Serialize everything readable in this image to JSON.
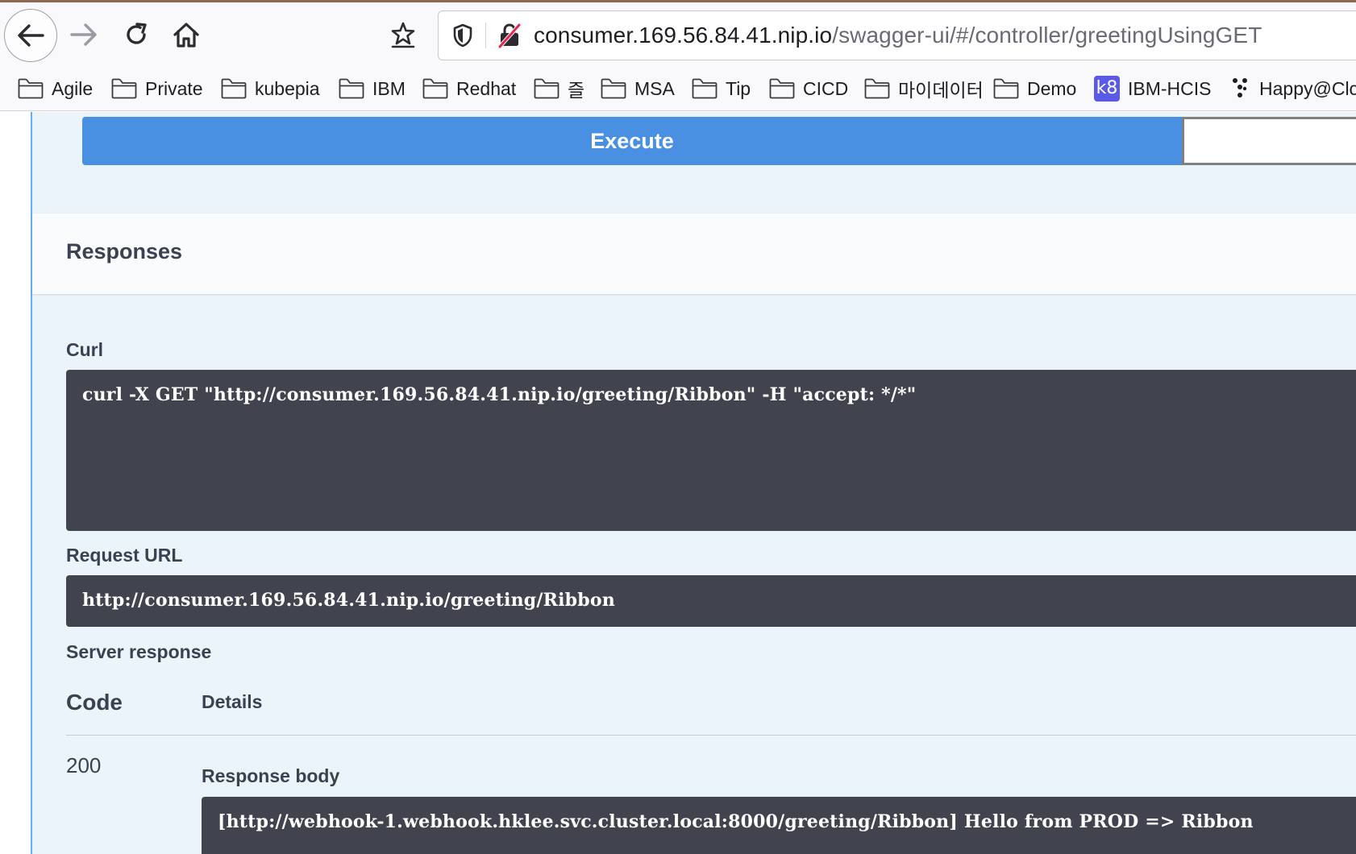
{
  "browser": {
    "url_host": "consumer.169.56.84.41.nip.io",
    "url_path": "/swagger-ui/#/controller/greetingUsingGET"
  },
  "bookmarks": [
    {
      "label": "Agile",
      "icon": "folder-icon"
    },
    {
      "label": "Private",
      "icon": "folder-icon"
    },
    {
      "label": "kubepia",
      "icon": "folder-icon"
    },
    {
      "label": "IBM",
      "icon": "folder-icon"
    },
    {
      "label": "Redhat",
      "icon": "folder-icon"
    },
    {
      "label": "즐",
      "icon": "folder-icon"
    },
    {
      "label": "MSA",
      "icon": "folder-icon"
    },
    {
      "label": "Tip",
      "icon": "folder-icon"
    },
    {
      "label": "CICD",
      "icon": "folder-icon"
    },
    {
      "label": "마이데이터",
      "icon": "folder-icon"
    },
    {
      "label": "Demo",
      "icon": "folder-icon"
    },
    {
      "label": "IBM-HCIS",
      "icon": "k8s-icon",
      "badge": "k8"
    },
    {
      "label": "Happy@Clc",
      "icon": "dots-icon"
    }
  ],
  "swagger": {
    "execute_label": "Execute",
    "responses_title": "Responses",
    "curl_label": "Curl",
    "curl_command": "curl -X GET \"http://consumer.169.56.84.41.nip.io/greeting/Ribbon\" -H \"accept: */*\"",
    "request_url_label": "Request URL",
    "request_url": "http://consumer.169.56.84.41.nip.io/greeting/Ribbon",
    "server_response_label": "Server response",
    "code_header": "Code",
    "details_header": "Details",
    "status_code": "200",
    "response_body_label": "Response body",
    "response_body": "[http://webhook-1.webhook.hklee.svc.cluster.local:8000/greeting/Ribbon] Hello from PROD => Ribbon"
  },
  "colors": {
    "execute": "#4990e2",
    "code_bg": "#41444e",
    "panel_bg": "#ebf3fb",
    "get_accent": "#61affe"
  }
}
